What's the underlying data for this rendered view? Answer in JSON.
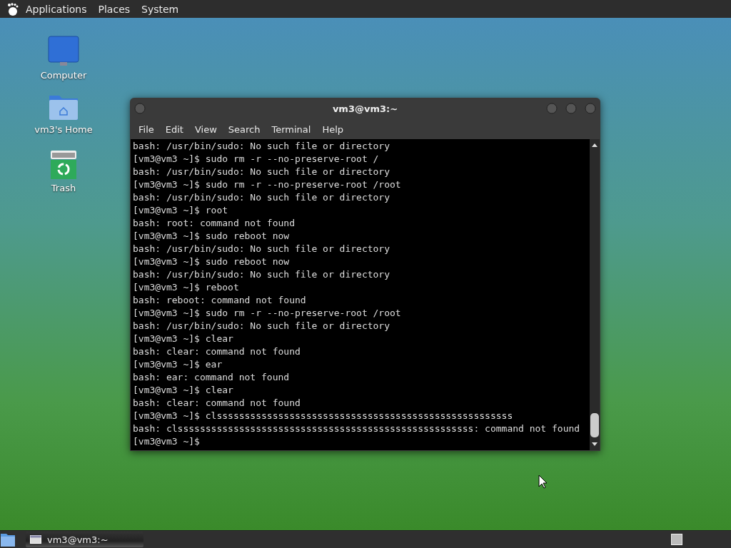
{
  "top_panel": {
    "menus": [
      "Applications",
      "Places",
      "System"
    ]
  },
  "desktop_icons": [
    {
      "kind": "computer",
      "label": "Computer"
    },
    {
      "kind": "home",
      "label": "vm3's Home"
    },
    {
      "kind": "trash",
      "label": "Trash"
    }
  ],
  "window": {
    "title": "vm3@vm3:~",
    "menu": [
      "File",
      "Edit",
      "View",
      "Search",
      "Terminal",
      "Help"
    ],
    "lines": [
      "bash: /usr/bin/sudo: No such file or directory",
      "[vm3@vm3 ~]$ sudo rm -r --no-preserve-root /",
      "bash: /usr/bin/sudo: No such file or directory",
      "[vm3@vm3 ~]$ sudo rm -r --no-preserve-root /root",
      "bash: /usr/bin/sudo: No such file or directory",
      "[vm3@vm3 ~]$ root",
      "bash: root: command not found",
      "[vm3@vm3 ~]$ sudo reboot now",
      "bash: /usr/bin/sudo: No such file or directory",
      "[vm3@vm3 ~]$ sudo reboot now",
      "bash: /usr/bin/sudo: No such file or directory",
      "[vm3@vm3 ~]$ reboot",
      "bash: reboot: command not found",
      "[vm3@vm3 ~]$ sudo rm -r --no-preserve-root /root",
      "bash: /usr/bin/sudo: No such file or directory",
      "[vm3@vm3 ~]$ clear",
      "bash: clear: command not found",
      "[vm3@vm3 ~]$ ear",
      "bash: ear: command not found",
      "[vm3@vm3 ~]$ clear",
      "bash: clear: command not found",
      "[vm3@vm3 ~]$ clsssssssssssssssssssssssssssssssssssssssssssssssssssss",
      "bash: clsssssssssssssssssssssssssssssssssssssssssssssssssssss: command not found",
      "[vm3@vm3 ~]$"
    ]
  },
  "taskbar": {
    "tasks": [
      {
        "label": "vm3@vm3:~",
        "selected": false
      }
    ]
  }
}
